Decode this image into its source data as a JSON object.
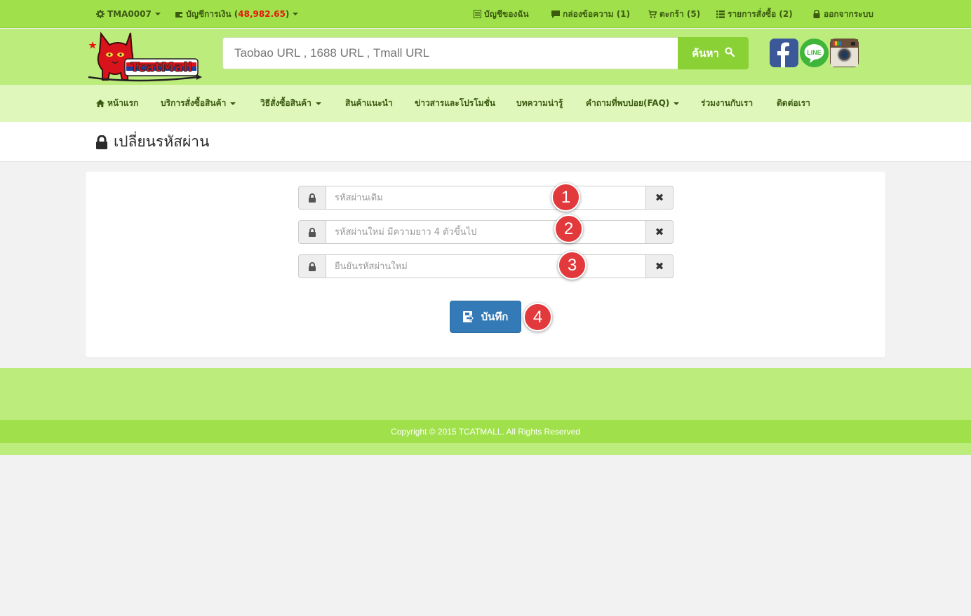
{
  "topbar": {
    "user": "TMA0007",
    "wallet_label": "บัญชีการเงิน (",
    "wallet_amount": "48,982.65",
    "wallet_close": ")",
    "my_account": "บัญชีของฉัน",
    "messages": "กล่องข้อความ (1)",
    "cart": "ตะกร้า (5)",
    "orders": "รายการสั่งซื้อ (2)",
    "logout": "ออกจากระบบ"
  },
  "header": {
    "search_placeholder": "Taobao URL , 1688 URL , Tmall URL",
    "search_button": "ค้นหา",
    "logo_text": "TcatMall",
    "social": [
      "facebook-icon",
      "line-icon",
      "instagram-icon"
    ]
  },
  "nav": {
    "items": [
      {
        "label": "หน้าแรก"
      },
      {
        "label": "บริการสั่งซื้อสินค้า"
      },
      {
        "label": "วิธีสั่งซื้อสินค้า"
      },
      {
        "label": "สินค้าแนะนำ"
      },
      {
        "label": "ข่าวสารและโปรโมชั่น"
      },
      {
        "label": "บทความน่ารู้"
      },
      {
        "label": "คำถามที่พบบ่อย(FAQ)"
      },
      {
        "label": "ร่วมงานกับเรา"
      },
      {
        "label": "ติดต่อเรา"
      }
    ]
  },
  "page": {
    "title": "เปลี่ยนรหัสผ่าน"
  },
  "form": {
    "fields": [
      {
        "placeholder": "รหัสผ่านเดิม",
        "marker": "1"
      },
      {
        "placeholder": "รหัสผ่านใหม่ มีความยาว 4 ตัวขึ้นไป",
        "marker": "2"
      },
      {
        "placeholder": "ยืนยันรหัสผ่านใหม่",
        "marker": "3"
      }
    ],
    "save_label": "บันทึก",
    "save_marker": "4"
  },
  "footer": {
    "copyright": "Copyright © 2015 TCATMALL. All Rights Reserved"
  },
  "colors": {
    "topbar": "#a0e14b",
    "header": "#bbec7c",
    "nav": "#e0f7bb",
    "primary_button": "#337ab7",
    "marker": "#e2393d"
  }
}
